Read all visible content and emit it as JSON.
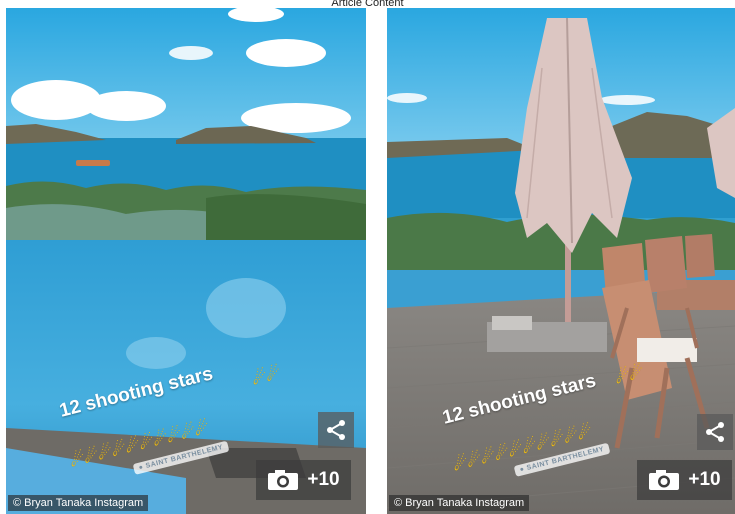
{
  "top_caption": "Article Content",
  "panels": [
    {
      "caption": "12 shooting stars",
      "stars_count": 12,
      "location_tag": "SAINT BARTHELEMY",
      "photo_count": "+10",
      "credit": "© Bryan Tanaka Instagram",
      "share_icon": "share-icon",
      "camera_icon": "camera-icon"
    },
    {
      "caption": "12 shooting stars",
      "stars_count": 12,
      "location_tag": "SAINT BARTHELEMY",
      "photo_count": "+10",
      "credit": "© Bryan Tanaka Instagram",
      "share_icon": "share-icon",
      "camera_icon": "camera-icon"
    }
  ],
  "colors": {
    "sky": "#3fb3e3",
    "sea": "#1f97c9",
    "pool": "#3aa6d8",
    "star": "#f7c514"
  }
}
